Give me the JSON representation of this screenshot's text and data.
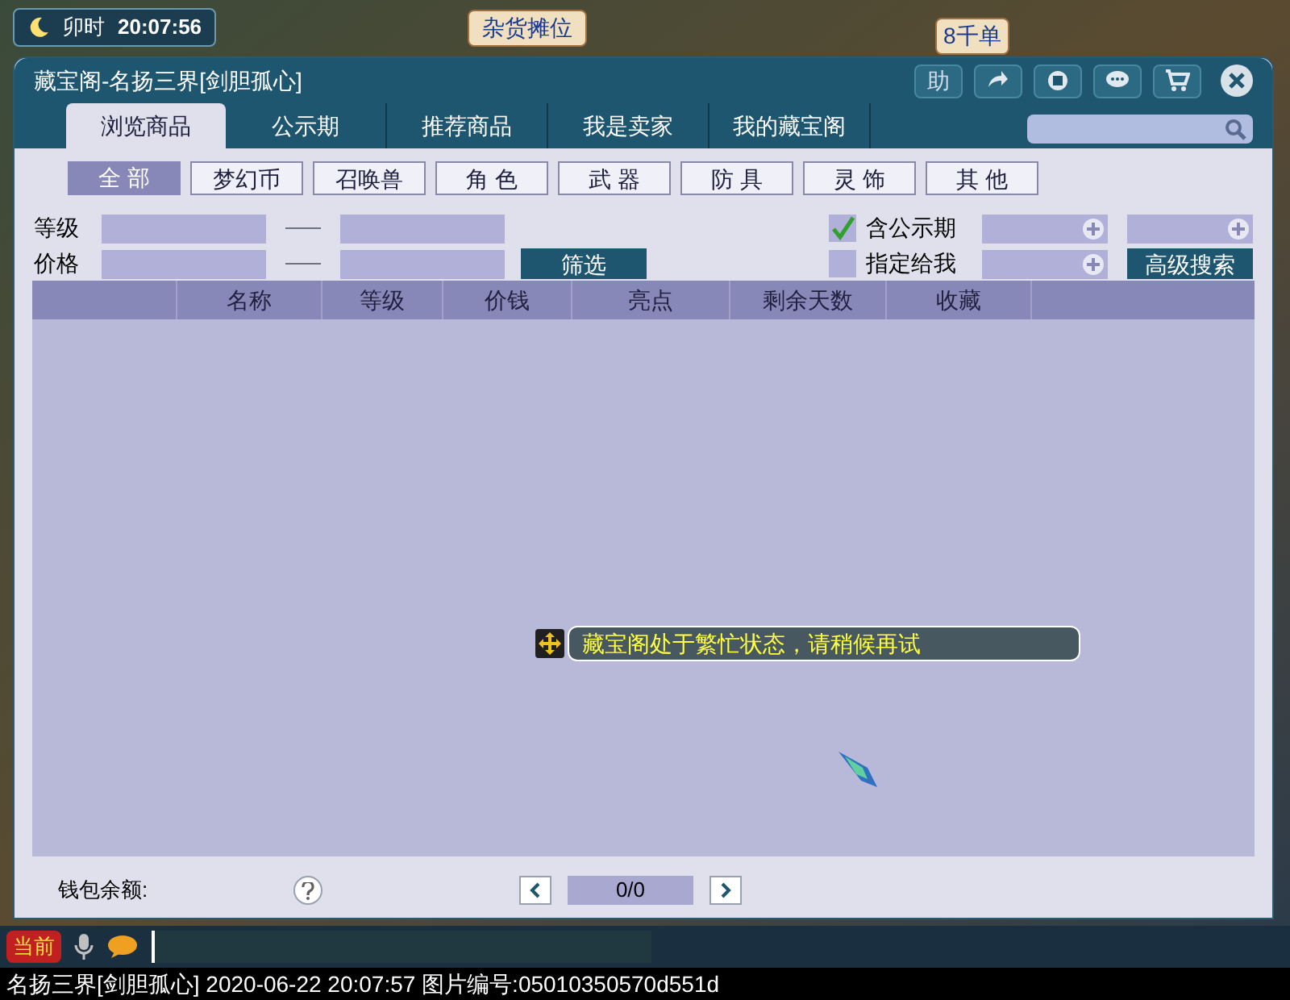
{
  "hud": {
    "time_period": "卯时",
    "clock": "20:07:56",
    "stall_label": "杂货摊位",
    "order_label": "8千单",
    "chat_channel": "当前"
  },
  "window": {
    "title": "藏宝阁-名扬三界[剑胆孤心]",
    "toolbar": [
      {
        "kind": "text",
        "label": "助"
      },
      {
        "kind": "share"
      },
      {
        "kind": "stop"
      },
      {
        "kind": "chat"
      },
      {
        "kind": "cart"
      }
    ]
  },
  "tabs": [
    {
      "label": "浏览商品",
      "selected": true
    },
    {
      "label": "公示期",
      "selected": false
    },
    {
      "label": "推荐商品",
      "selected": false
    },
    {
      "label": "我是卖家",
      "selected": false
    },
    {
      "label": "我的藏宝阁",
      "selected": false
    }
  ],
  "categories": [
    {
      "label": "全 部",
      "selected": true
    },
    {
      "label": "梦幻币",
      "selected": false
    },
    {
      "label": "召唤兽",
      "selected": false
    },
    {
      "label": "角 色",
      "selected": false
    },
    {
      "label": "武 器",
      "selected": false
    },
    {
      "label": "防 具",
      "selected": false
    },
    {
      "label": "灵 饰",
      "selected": false
    },
    {
      "label": "其 他",
      "selected": false
    }
  ],
  "filters": {
    "level_label": "等级",
    "price_label": "价格",
    "filter_button": "筛选",
    "options": [
      {
        "label": "含公示期",
        "checked": true
      },
      {
        "label": "指定给我",
        "checked": false
      }
    ],
    "advanced_button": "高级搜索"
  },
  "table": {
    "columns": [
      "名称",
      "等级",
      "价钱",
      "亮点",
      "剩余天数",
      "收藏"
    ]
  },
  "message": "藏宝阁处于繁忙状态，请稍候再试",
  "footer": {
    "wallet_label": "钱包余额:",
    "page": "0/0"
  },
  "status_bar": "名扬三界[剑胆孤心] 2020-06-22 20:07:57 图片编号:05010350570d551d"
}
